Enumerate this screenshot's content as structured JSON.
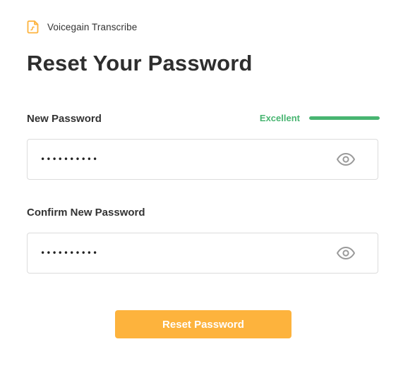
{
  "brand": {
    "name": "Voicegain Transcribe",
    "icon": "document-audio-icon",
    "accent": "#fdb33d"
  },
  "page": {
    "title": "Reset Your Password"
  },
  "new_password": {
    "label": "New Password",
    "value": "••••••••••",
    "visibility_icon": "eye-icon",
    "strength": {
      "label": "Excellent",
      "level": 1.0,
      "color": "#48b571"
    }
  },
  "confirm_password": {
    "label": "Confirm New Password",
    "value": "••••••••••",
    "visibility_icon": "eye-icon"
  },
  "submit": {
    "label": "Reset Password",
    "color": "#fdb33d"
  }
}
